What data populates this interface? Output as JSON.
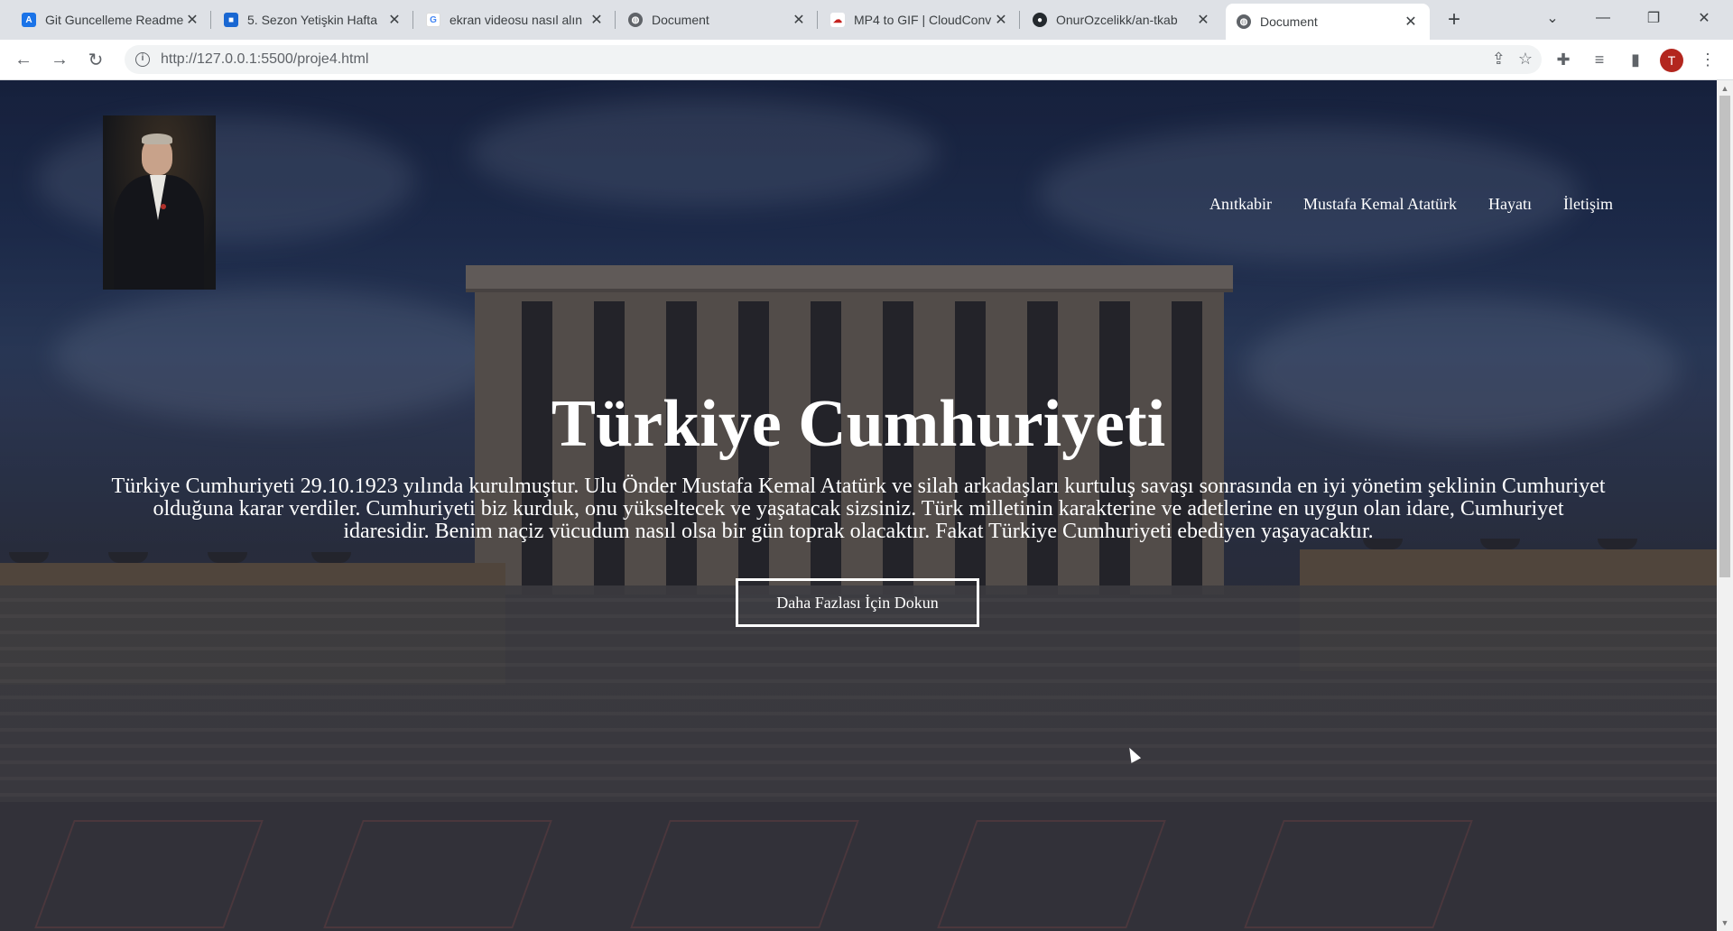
{
  "browser": {
    "tabs": [
      {
        "title": "Git Guncelleme Readme",
        "favicon": "azure-devops-icon",
        "color": "#1a73e8",
        "glyph": "A"
      },
      {
        "title": "5. Sezon Yetişkin Hafta",
        "favicon": "classroom-icon",
        "color": "#1967d2",
        "glyph": "■"
      },
      {
        "title": "ekran videosu nasıl alın",
        "favicon": "google-icon",
        "color": "#4285f4",
        "glyph": "G"
      },
      {
        "title": "Document",
        "favicon": "globe-icon",
        "color": "#5f6368",
        "glyph": "◍"
      },
      {
        "title": "MP4 to GIF | CloudConv",
        "favicon": "cloud-icon",
        "color": "#c5221f",
        "glyph": "☁"
      },
      {
        "title": "OnurOzcelikk/an-tkab",
        "favicon": "github-icon",
        "color": "#24292e",
        "glyph": "●"
      },
      {
        "title": "Document",
        "favicon": "globe-icon",
        "color": "#5f6368",
        "glyph": "◍",
        "active": true
      }
    ],
    "new_tab_label": "+",
    "url": "http://127.0.0.1:5500/proje4.html",
    "profile_initial": "T"
  },
  "page": {
    "nav": [
      "Anıtkabir",
      "Mustafa Kemal Atatürk",
      "Hayatı",
      "İletişim"
    ],
    "title": "Türkiye Cumhuriyeti",
    "description": "Türkiye Cumhuriyeti 29.10.1923 yılında kurulmuştur. Ulu Önder Mustafa Kemal Atatürk ve silah arkadaşları kurtuluş savaşı sonrasında en iyi yönetim şeklinin Cumhuriyet olduğuna karar verdiler. Cumhuriyeti biz kurduk, onu yükseltecek ve yaşatacak sizsiniz. Türk milletinin karakterine ve adetlerine en uygun olan idare, Cumhuriyet idaresidir. Benim naçiz vücudum nasıl olsa bir gün toprak olacaktır. Fakat Türkiye Cumhuriyeti ebediyen yaşayacaktır.",
    "cta_label": "Daha Fazlası İçin Dokun"
  }
}
